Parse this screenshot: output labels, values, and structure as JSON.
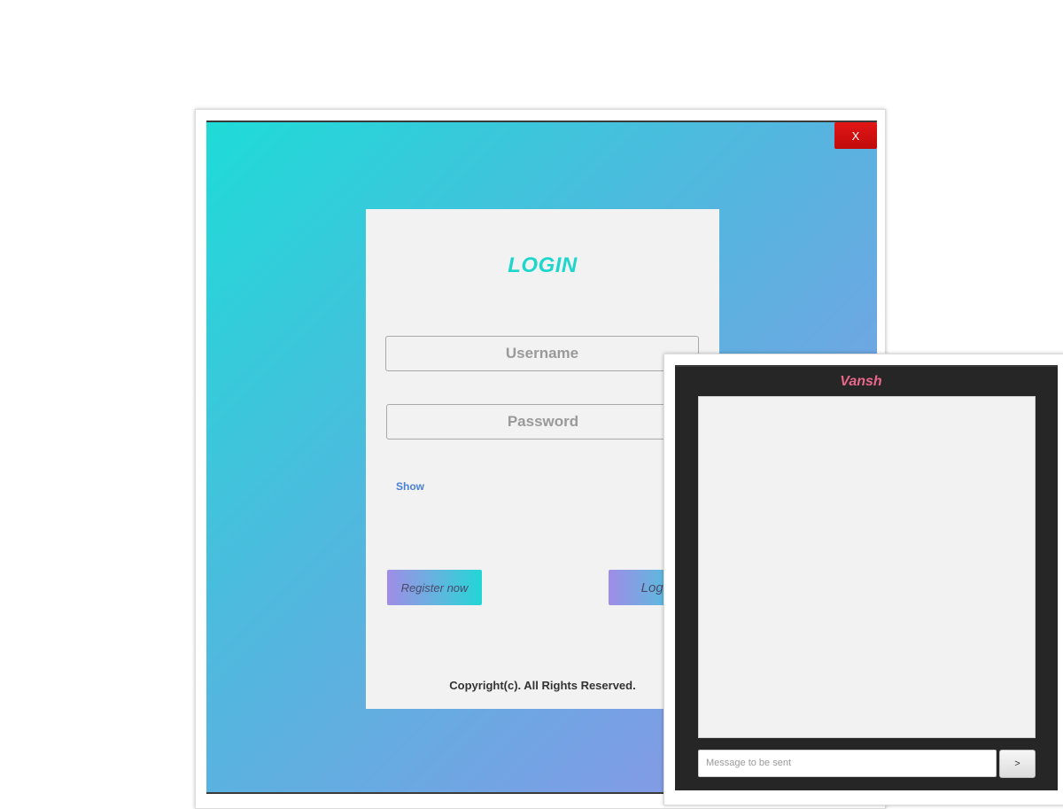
{
  "login_window": {
    "close_label": "X",
    "title": "LOGIN",
    "username_placeholder": "Username",
    "password_placeholder": "Password",
    "show_label": "Show",
    "register_label": "Register now",
    "login_label": "Login",
    "copyright": "Copyright(c). All Rights Reserved.",
    "colors": {
      "gradient_start": "#1edbd7",
      "gradient_end": "#9590e6",
      "title": "#1ed6cc",
      "close_button": "#d41010"
    }
  },
  "chat_window": {
    "title": "Vansh",
    "message_placeholder": "Message to be sent",
    "send_label": ">",
    "colors": {
      "background": "#262626",
      "title": "#e8678a"
    }
  }
}
